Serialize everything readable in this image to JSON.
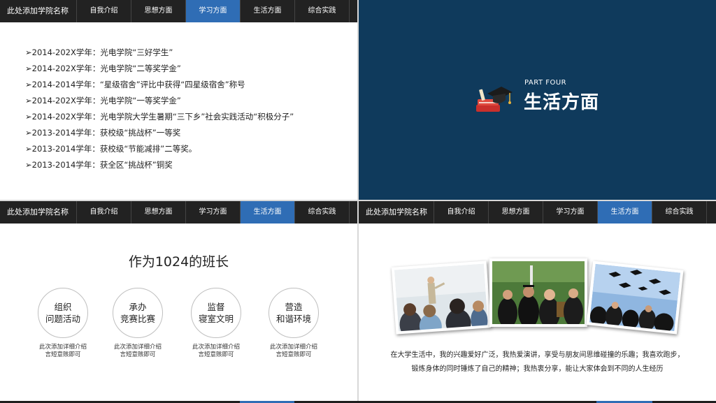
{
  "nav": {
    "brand": "此处添加学院名称",
    "tabs": [
      "自我介绍",
      "思想方面",
      "学习方面",
      "生活方面",
      "综合实践"
    ]
  },
  "slide1": {
    "awards": [
      "➢2014-202X学年：光电学院“三好学生”",
      "➢2014-202X学年：光电学院“二等奖学金”",
      "➢2014-2014学年：“星级宿舍”评比中获得“四星级宿舍”称号",
      "➢2014-202X学年：光电学院“一等奖学金”",
      "➢2014-202X学年：光电学院大学生暑期“三下乡”社会实践活动“积极分子”",
      "➢2013-2014学年：获校级“挑战杯”一等奖",
      "➢2013-2014学年：获校级“节能减排”二等奖。",
      "➢2013-2014学年：获全区“挑战杯”铜奖"
    ]
  },
  "slide2": {
    "part_label": "PART FOUR",
    "title": "生活方面",
    "bg_color": "#0f3a5c"
  },
  "slide3": {
    "title": "作为1024的班长",
    "items": [
      {
        "line1": "组织",
        "line2": "问题活动",
        "desc1": "此次添加详细介绍",
        "desc2": "言短意赅即可"
      },
      {
        "line1": "承办",
        "line2": "竞赛比赛",
        "desc1": "此次添加详细介绍",
        "desc2": "言短意赅即可"
      },
      {
        "line1": "监督",
        "line2": "寝室文明",
        "desc1": "此次添加详细介绍",
        "desc2": "言短意赅即可"
      },
      {
        "line1": "营造",
        "line2": "和谐环境",
        "desc1": "此次添加详细介绍",
        "desc2": "言短意赅即可"
      }
    ]
  },
  "slide4": {
    "text1": "在大学生活中，我的兴趣爱好广泛，我热爱演讲，享受与朋友间思维碰撞的乐趣；我喜欢跑步，",
    "text2": "锻炼身体的同时锤炼了自己的精神；我热衷分享，能让大家体会到不同的人生经历"
  },
  "colors": {
    "nav_bg": "#222222",
    "active_tab": "#2f6db5"
  }
}
